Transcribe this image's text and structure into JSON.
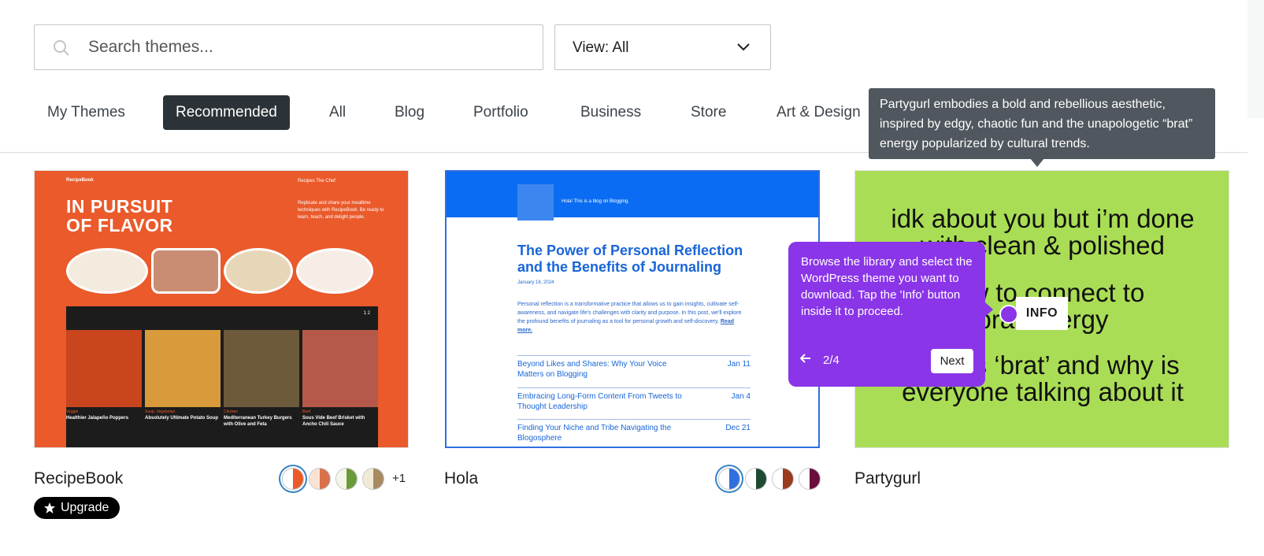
{
  "search": {
    "placeholder": "Search themes...",
    "icon": "search-icon"
  },
  "view_filter": {
    "label": "View: All",
    "icon": "chevron-down-icon"
  },
  "tabs": [
    {
      "label": "My Themes",
      "active": false
    },
    {
      "label": "Recommended",
      "active": true
    },
    {
      "label": "All",
      "active": false
    },
    {
      "label": "Blog",
      "active": false
    },
    {
      "label": "Portfolio",
      "active": false
    },
    {
      "label": "Business",
      "active": false
    },
    {
      "label": "Store",
      "active": false
    },
    {
      "label": "Art & Design",
      "active": false
    }
  ],
  "themes": [
    {
      "name": "RecipeBook",
      "badge": "Upgrade",
      "badge_icon": "star-icon",
      "more_styles": "+1",
      "swatches": [
        [
          "#ffffff",
          "#ea5a2b"
        ],
        [
          "#fbe3d3",
          "#d9714b"
        ],
        [
          "#f2f7e6",
          "#6b9a3a"
        ],
        [
          "#f1ead6",
          "#a88b63"
        ]
      ],
      "preview": {
        "brand": "RecipeBook",
        "nav": "Recipes   The Chef",
        "title": "IN PURSUIT OF FLAVOR",
        "blurb": "Replicate and share your mealtime techniques with RecipeBook. Be ready to learn, teach, and delight people.",
        "page_count": "1 2",
        "items": [
          {
            "tag": "Veggie",
            "title": "Healthier Jalapeño Poppers"
          },
          {
            "tag": "Soup, Vegetarian",
            "title": "Absolutely Ultimate Potato Soup"
          },
          {
            "tag": "Chicken",
            "title": "Mediterranean Turkey Burgers with Olive and Feta"
          },
          {
            "tag": "Beef",
            "title": "Sous Vide Beef Brisket with Ancho Chili Sauce"
          }
        ]
      }
    },
    {
      "name": "Hola",
      "swatches": [
        [
          "#ffffff",
          "#2f6fde"
        ],
        [
          "#ffffff",
          "#1e4a32"
        ],
        [
          "#ffffff",
          "#9a3a1f"
        ],
        [
          "#ffffff",
          "#6a0d3d"
        ]
      ],
      "preview": {
        "greeting": "Hola!   This is a blog on Blogging.",
        "title": "The Power of Personal Reflection and the Benefits of Journaling",
        "date": "January 18, 2024",
        "body": "Personal reflection is a transformative practice that allows us to gain insights, cultivate self-awareness, and navigate life's challenges with clarity and purpose. In this post, we'll explore the profound benefits of journaling as a tool for personal growth and self-discovery.",
        "read_more": "Read more.",
        "posts": [
          {
            "title": "Beyond Likes and Shares: Why Your Voice Matters on Blogging",
            "date": "Jan 11"
          },
          {
            "title": "Embracing Long-Form Content From Tweets to Thought Leadership",
            "date": "Jan 4"
          },
          {
            "title": "Finding Your Niche and Tribe Navigating the Blogosphere",
            "date": "Dec 21"
          }
        ]
      }
    },
    {
      "name": "Partygurl",
      "description": "Partygurl embodies a bold and rebellious aesthetic, inspired by edgy, chaotic fun and the unapologetic “brat” energy popularized by cultural trends.",
      "preview": {
        "lines": [
          "idk about you but i’m done",
          "with clean & polished",
          "how to connect to",
          "brat energy",
          "what is ‘brat’ and why is",
          "everyone talking about it"
        ]
      }
    }
  ],
  "tour": {
    "text": "Browse the library and select the WordPress theme you want to download. Tap the 'Info' button inside it to proceed.",
    "step": "2/4",
    "next_label": "Next",
    "back_icon": "arrow-left-icon",
    "highlight_label": "INFO",
    "color": "#8a35e8"
  }
}
